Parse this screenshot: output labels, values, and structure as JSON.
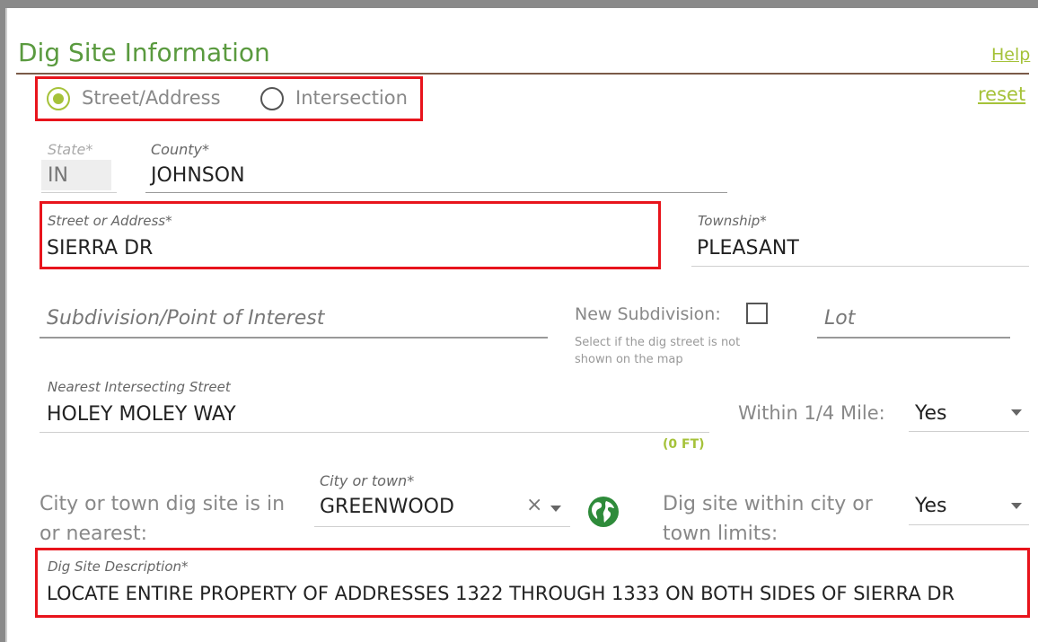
{
  "section": {
    "title": "Dig Site Information",
    "help": "Help",
    "reset": "reset"
  },
  "location_type": {
    "options": [
      {
        "label": "Street/Address",
        "selected": true
      },
      {
        "label": "Intersection",
        "selected": false
      }
    ]
  },
  "fields": {
    "state": {
      "label": "State*",
      "value": "IN"
    },
    "county": {
      "label": "County*",
      "value": "JOHNSON"
    },
    "street": {
      "label": "Street or Address*",
      "value": "SIERRA DR"
    },
    "township": {
      "label": "Township*",
      "value": "PLEASANT"
    },
    "subdivision": {
      "placeholder": "Subdivision/Point of Interest"
    },
    "new_subdivision": {
      "label": "New Subdivision:",
      "checked": false,
      "help_line1": "Select if the dig street is not",
      "help_line2": "shown on the map"
    },
    "lot": {
      "placeholder": "Lot"
    },
    "nearest_street": {
      "label": "Nearest Intersecting Street",
      "value": "HOLEY MOLEY WAY",
      "distance": "(0 FT)"
    },
    "within_quarter_mile": {
      "label": "Within 1/4 Mile:",
      "value": "Yes"
    },
    "city_prompt": {
      "line1": "City or town dig site is in",
      "line2": "or nearest:"
    },
    "city": {
      "label": "City or town*",
      "value": "GREENWOOD",
      "clear": "×"
    },
    "within_city_limits": {
      "line1": "Dig site within city or",
      "line2": "town limits:",
      "value": "Yes"
    },
    "description": {
      "label": "Dig Site Description*",
      "value": "LOCATE ENTIRE PROPERTY OF ADDRESSES 1322 THROUGH 1333 ON BOTH SIDES OF SIERRA DR"
    }
  },
  "colors": {
    "accent": "#a5c239",
    "title": "#5a9a3f",
    "highlight": "#e8141c",
    "globe": "#2e8b3a"
  },
  "icons": {
    "globe": "globe-icon",
    "clear": "clear-icon",
    "dropdown": "chevron-down-icon"
  }
}
